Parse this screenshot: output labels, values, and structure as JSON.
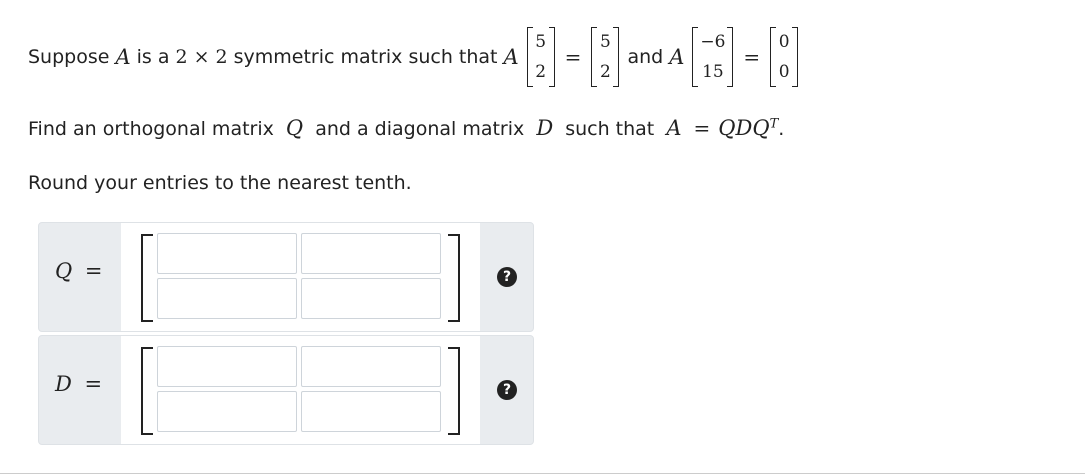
{
  "problem": {
    "intro": "Suppose",
    "A": "A",
    "is_a": "is a",
    "dim1": "2",
    "times": "×",
    "dim2": "2",
    "symmetric_text": "symmetric matrix such that",
    "v1": [
      "5",
      "2"
    ],
    "eq": "=",
    "r1": [
      "5",
      "2"
    ],
    "and": "and",
    "v2": [
      "−6",
      "15"
    ],
    "r2": [
      "0",
      "0"
    ],
    "find_text_1": "Find an orthogonal matrix",
    "Q": "Q",
    "find_text_2": "and a diagonal matrix",
    "D": "D",
    "find_text_3": "such that",
    "decomp": "QDQ",
    "T": "T",
    "period": ".",
    "round_text": "Round your entries to the nearest tenth."
  },
  "answers": {
    "q_label": "Q",
    "d_label": "D",
    "eq": "=",
    "help_glyph": "?"
  }
}
